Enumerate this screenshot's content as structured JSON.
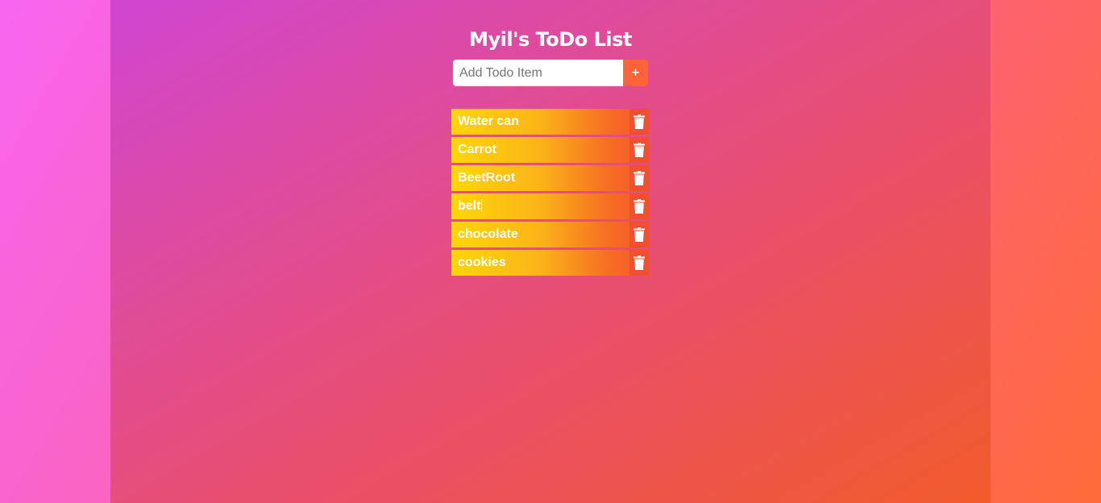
{
  "app": {
    "title": "Myil's ToDo List"
  },
  "form": {
    "placeholder": "Add Todo Item",
    "value": "",
    "add_label": "+"
  },
  "todos": [
    {
      "text": "Water can"
    },
    {
      "text": "Carrot"
    },
    {
      "text": "BeetRoot"
    },
    {
      "text": "belt"
    },
    {
      "text": "chocolate"
    },
    {
      "text": "cookies"
    }
  ],
  "icons": {
    "delete": "trash-icon"
  },
  "colors": {
    "add_button": "#ff6438",
    "item_start": "#ffd60a",
    "item_end": "#f4572c",
    "text": "#ffffff"
  }
}
